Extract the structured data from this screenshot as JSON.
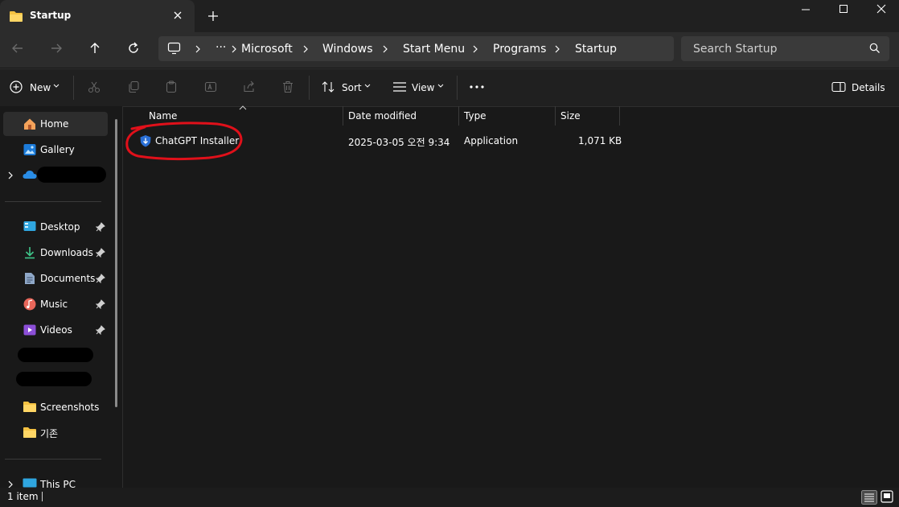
{
  "tab": {
    "title": "Startup",
    "close_icon": "close-icon",
    "new_tab_icon": "plus-icon"
  },
  "window_controls": {
    "minimize": "minimize-icon",
    "maximize": "maximize-icon",
    "close": "close-icon"
  },
  "address": {
    "crumbs": [
      "Microsoft",
      "Windows",
      "Start Menu",
      "Programs",
      "Startup"
    ],
    "overflow": "···",
    "search_placeholder": "Search Startup"
  },
  "toolbar": {
    "new_label": "New",
    "sort_label": "Sort",
    "view_label": "View",
    "details_label": "Details"
  },
  "sidebar": {
    "home": "Home",
    "gallery": "Gallery",
    "quick_access": [
      "Desktop",
      "Downloads",
      "Documents",
      "Music",
      "Videos"
    ],
    "folders": [
      "Screenshots",
      "기존"
    ],
    "this_pc": "This PC"
  },
  "columns": {
    "name": "Name",
    "date": "Date modified",
    "type": "Type",
    "size": "Size"
  },
  "files": [
    {
      "name": "ChatGPT Installer",
      "date": "2025-03-05 오전 9:34",
      "type": "Application",
      "size": "1,071 KB"
    }
  ],
  "status": {
    "count": "1 item"
  },
  "colors": {
    "accent": "#4cc2ff",
    "annotation": "#e0101a",
    "folder": "#f5c242"
  }
}
